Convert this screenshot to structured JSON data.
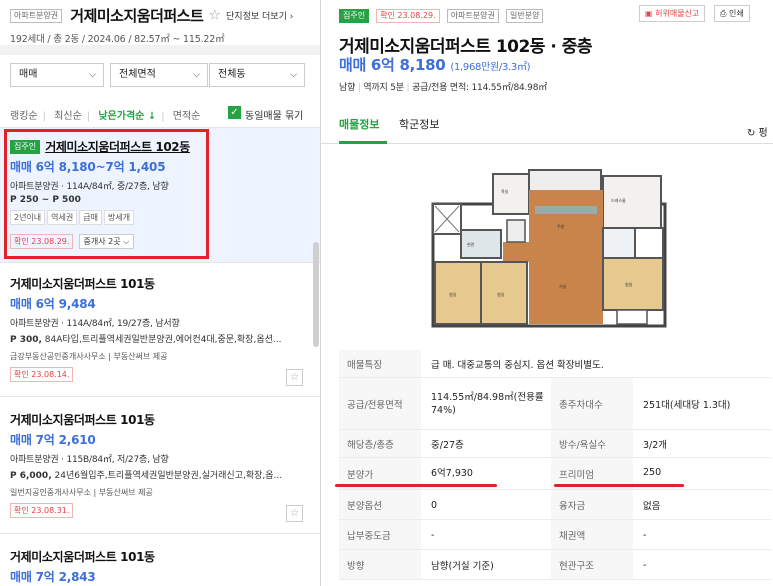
{
  "left": {
    "header": {
      "tag": "아파트분양권",
      "title": "거제미소지움더퍼스트",
      "star": "☆",
      "link": "단지정보 더보기 ›",
      "subinfo": "192세대 / 총 2동 / 2024.06 / 82.57㎡ ~ 115.22㎡"
    },
    "filters": [
      {
        "label": "매매"
      },
      {
        "label": "전체면적"
      },
      {
        "label": "전체동"
      }
    ],
    "sorts": {
      "items": [
        "랭킹순",
        "최신순",
        "낮은가격순 ↓",
        "면적순"
      ],
      "checkbox_label": "동일매물 묶기"
    },
    "listings": [
      {
        "tag": "집주인",
        "name": "거제미소지움더퍼스트 102동",
        "price": "매매 6억 8,180~7억 1,405",
        "info": "아파트분양권 · 114A/84㎡, 중/27층, 남향",
        "info2": "P 250 ~ P 500",
        "chips": [
          "2년이내",
          "역세권",
          "급매",
          "방세개"
        ],
        "confirm": "확인 23.08.29.",
        "agents": "중개사 2곳 ⌵"
      },
      {
        "name": "거제미소지움더퍼스트 101동",
        "price": "매매 6억 9,484",
        "info": "아파트분양권 · 114A/84㎡, 19/27층, 남서향",
        "info2_bold": "P 300,",
        "info2": " 84A타입,트리플역세권일반분양권,에어컨4대,중문,확장,옵션...",
        "agent": "금강부동산공인중개사사무소  |  부동산써브 제공",
        "confirm": "확인 23.08.14."
      },
      {
        "name": "거제미소지움더퍼스트 101동",
        "price": "매매 7억 2,610",
        "info": "아파트분양권 · 115B/84㎡, 저/27층, 남향",
        "info2_bold": "P 6,000,",
        "info2": " 24년6월입주,트리플역세권일반분양권,실거래신고,확장,옵...",
        "agent": "일번지공인중개사사무소  |  부동산써브 제공",
        "confirm": "확인 23.08.31."
      },
      {
        "name": "거제미소지움더퍼스트 101동",
        "price": "매매 7억 2,843"
      }
    ]
  },
  "right": {
    "tags": [
      "집주인",
      "확인 23.08.29.",
      "아파트분양권",
      "일반분양"
    ],
    "buttons": {
      "report": "허위매물신고",
      "print": "인쇄"
    },
    "title": "거제미소지움더퍼스트 102동 · 중층",
    "price": "매매 6억 8,180",
    "price_per": "(1,968만원/3.3㎡)",
    "info": [
      "남향",
      "역까지 5분",
      "공급/전용 면적: 114.55㎡/84.98㎡"
    ],
    "tabs": [
      "매물정보",
      "학군정보"
    ],
    "refresh": "↻ 펑",
    "plan_labels": [
      "침실",
      "침실",
      "거실",
      "주방",
      "현관",
      "욕실",
      "드레스룸"
    ],
    "table": [
      {
        "k": "매물특징",
        "v": "급 매. 대중교통의 중심지. 옵션 확장비별도."
      },
      {
        "k": "공급/전용면적",
        "v": "114.55㎡/84.98㎡(전용률74%)",
        "k2": "총주차대수",
        "v2": "251대(세대당 1.3대)"
      },
      {
        "k": "해당층/총층",
        "v": "중/27층",
        "k2": "방수/욕실수",
        "v2": "3/2개"
      },
      {
        "k": "분양가",
        "v": "6억7,930",
        "k2": "프리미엄",
        "v2": "250"
      },
      {
        "k": "분양옵션",
        "v": "0",
        "k2": "융자금",
        "v2": "없음"
      },
      {
        "k": "납부중도금",
        "v": "-",
        "k2": "채권액",
        "v2": "-"
      },
      {
        "k": "방향",
        "v": "남향(거실 기준)",
        "k2": "현관구조",
        "v2": "-"
      }
    ]
  },
  "colors": {
    "accent_green": "#25a244",
    "price_blue": "#3d6fd9",
    "highlight_red": "#e2222b",
    "confirm_red": "#e04646"
  }
}
